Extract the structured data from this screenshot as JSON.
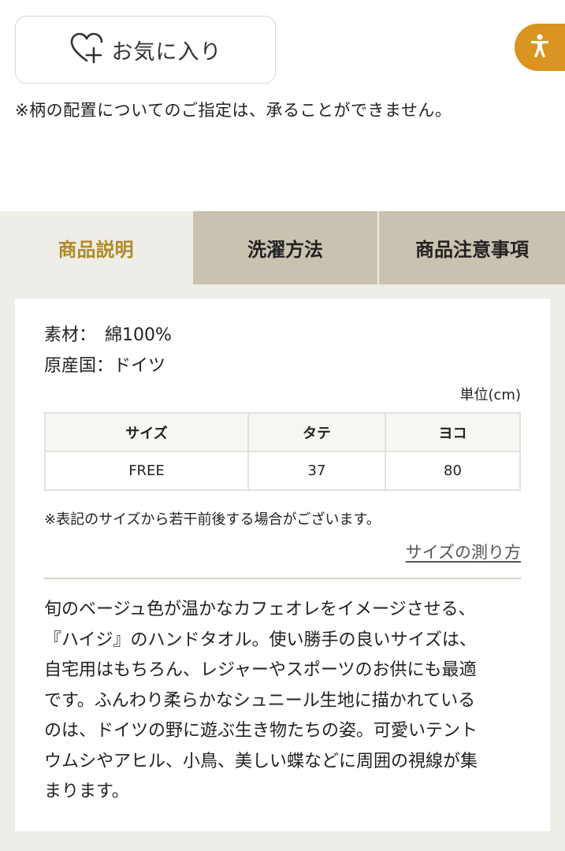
{
  "favorite": {
    "label": "お気に入り"
  },
  "accessibility": {
    "label": "accessibility-person-icon"
  },
  "notice": "※柄の配置についてのご指定は、承ることができません。",
  "tabs": [
    {
      "label": "商品説明",
      "active": true
    },
    {
      "label": "洗濯方法",
      "active": false
    },
    {
      "label": "商品注意事項",
      "active": false
    }
  ],
  "specs": {
    "material": "素材：　綿100%",
    "origin": "原産国：ドイツ"
  },
  "size_table": {
    "unit": "単位(cm)",
    "headers": [
      "サイズ",
      "タテ",
      "ヨコ"
    ],
    "rows": [
      [
        "FREE",
        "37",
        "80"
      ]
    ]
  },
  "size_note": "※表記のサイズから若干前後する場合がございます。",
  "howto_link": "サイズの測り方",
  "description_lines": [
    "旬のベージュ色が温かなカフェオレをイメージさせる、",
    "『ハイジ』のハンドタオル。使い勝手の良いサイズは、",
    "自宅用はもちろん、レジャーやスポーツのお供にも最適",
    "です。ふんわり柔らかなシュニール生地に描かれている",
    "のは、ドイツの野に遊ぶ生き物たちの姿。可愛いテント",
    "ウムシやアヒル、小鳥、美しい蝶などに周囲の視線が集",
    "まります。"
  ],
  "colors": {
    "accent": "#b08a26",
    "tab_inactive": "#cac2b0",
    "section_bg": "#efede8",
    "a11y": "#d99320"
  }
}
